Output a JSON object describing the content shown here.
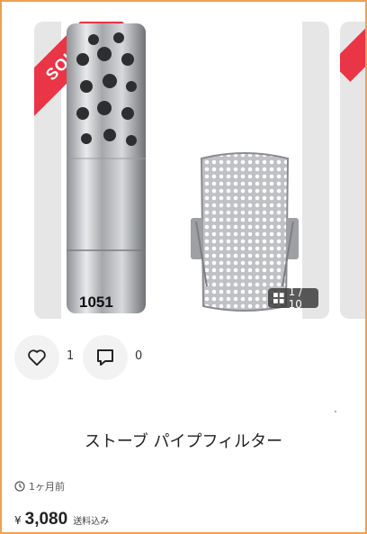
{
  "item": {
    "sold_badge": "SOLD",
    "photo_label": "1051",
    "image_counter": "1 / 10",
    "title": "ストーブ パイプフィルター",
    "posted": "1ヶ月前",
    "currency": "¥",
    "price": "3,080",
    "shipping": "送料込み"
  },
  "actions": {
    "like_count": "1",
    "comment_count": "0"
  },
  "icons": {
    "like": "heart-icon",
    "comment": "comment-icon",
    "counter": "grid-icon",
    "time": "clock-icon"
  },
  "colors": {
    "sold_band": "#ea3546",
    "border": "#f0a04e"
  }
}
